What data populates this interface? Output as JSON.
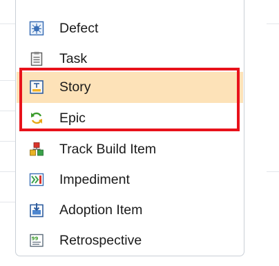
{
  "menu": {
    "items": [
      {
        "label": "Defect",
        "icon": "defect-icon"
      },
      {
        "label": "Task",
        "icon": "task-icon"
      },
      {
        "label": "Story",
        "icon": "story-icon",
        "highlighted": true
      },
      {
        "label": "Epic",
        "icon": "epic-icon"
      },
      {
        "label": "Track Build Item",
        "icon": "track-build-item-icon"
      },
      {
        "label": "Impediment",
        "icon": "impediment-icon"
      },
      {
        "label": "Adoption Item",
        "icon": "adoption-item-icon"
      },
      {
        "label": "Retrospective",
        "icon": "retrospective-icon"
      }
    ]
  },
  "colors": {
    "highlight_background": "#fde2b8",
    "annotation_border": "#e8121b",
    "menu_border": "#c9cfd6",
    "text": "#1a1a1a"
  }
}
